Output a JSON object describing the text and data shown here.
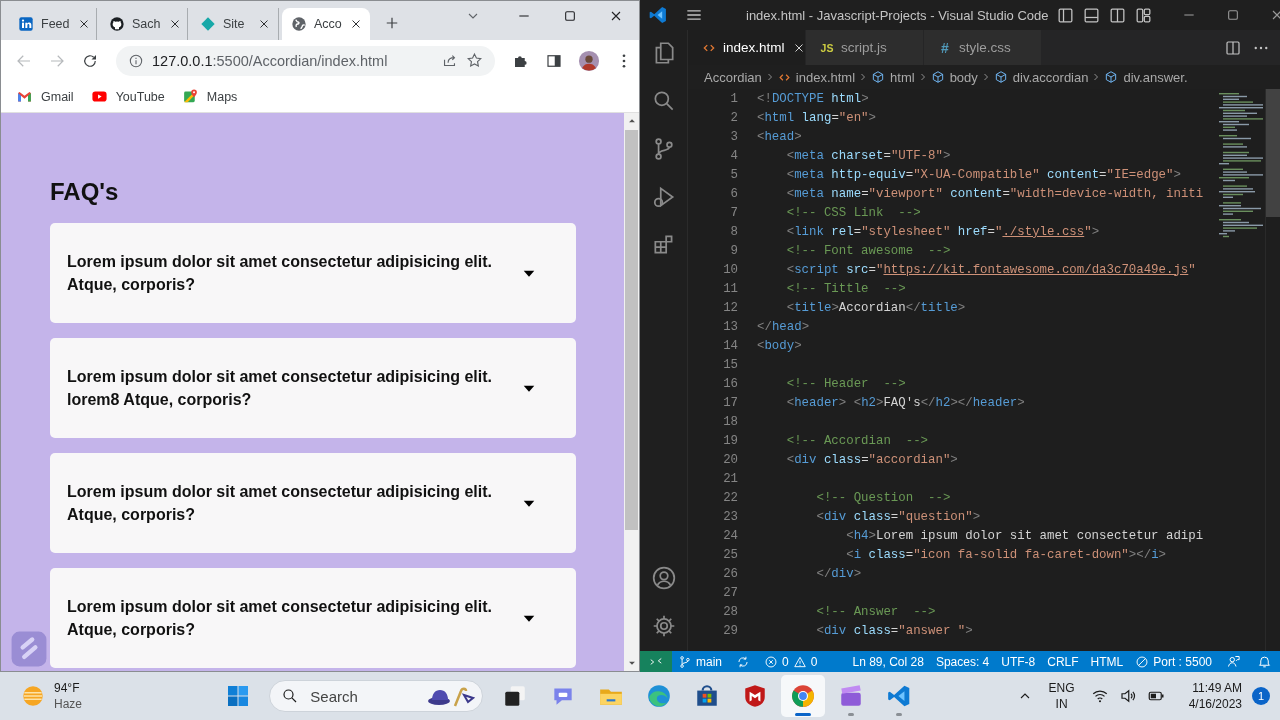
{
  "browser": {
    "tabs": [
      {
        "title": "Feed",
        "kind": "linkedin",
        "selected": false
      },
      {
        "title": "Sach",
        "kind": "github",
        "selected": false
      },
      {
        "title": "Site",
        "kind": "site",
        "selected": false
      },
      {
        "title": "Acco",
        "kind": "globe",
        "selected": true
      }
    ],
    "address": {
      "host": "127.0.0.1",
      "path": ":5500/Accordian/index.html"
    },
    "bookmarks": [
      {
        "label": "Gmail",
        "kind": "gmail"
      },
      {
        "label": "YouTube",
        "kind": "youtube"
      },
      {
        "label": "Maps",
        "kind": "maps"
      }
    ]
  },
  "page": {
    "heading": "FAQ's",
    "items": [
      {
        "question": "Lorem ipsum dolor sit amet consectetur adipisicing elit. Atque, corporis?",
        "expanded": false
      },
      {
        "question": "Lorem ipsum dolor sit amet consectetur adipisicing elit. lorem8 Atque, corporis?",
        "expanded": false
      },
      {
        "question": "Lorem ipsum dolor sit amet consectetur adipisicing elit. Atque, corporis?",
        "expanded": false
      },
      {
        "question": "Lorem ipsum dolor sit amet consectetur adipisicing elit. Atque, corporis?",
        "expanded": false
      }
    ]
  },
  "editor": {
    "title": "index.html - Javascript-Projects - Visual Studio Code",
    "tabs": [
      {
        "label": "index.html",
        "kind": "html",
        "selected": true
      },
      {
        "label": "script.js",
        "kind": "js",
        "icon_label": "JS",
        "selected": false
      },
      {
        "label": "style.css",
        "kind": "css",
        "icon_label": "#",
        "selected": false
      }
    ],
    "breadcrumbs": [
      {
        "label": "Accordian",
        "kind": "folder"
      },
      {
        "label": "index.html",
        "kind": "html"
      },
      {
        "label": "html",
        "kind": "element"
      },
      {
        "label": "body",
        "kind": "element"
      },
      {
        "label": "div.accordian",
        "kind": "element"
      },
      {
        "label": "div.answer.",
        "kind": "element"
      }
    ],
    "lines": [
      {
        "number": "1",
        "tokens": [
          {
            "kind": "punct",
            "text": "<!"
          },
          {
            "kind": "tag",
            "text": "DOCTYPE"
          },
          {
            "kind": "attr",
            "text": " html"
          },
          {
            "kind": "punct",
            "text": ">"
          }
        ]
      },
      {
        "number": "2",
        "tokens": [
          {
            "kind": "punct",
            "text": "<"
          },
          {
            "kind": "tag",
            "text": "html"
          },
          {
            "kind": "attr",
            "text": " lang"
          },
          {
            "kind": "op",
            "text": "="
          },
          {
            "kind": "string",
            "text": "\"en\""
          },
          {
            "kind": "punct",
            "text": ">"
          }
        ]
      },
      {
        "number": "3",
        "tokens": [
          {
            "kind": "punct",
            "text": "<"
          },
          {
            "kind": "tag",
            "text": "head"
          },
          {
            "kind": "punct",
            "text": ">"
          }
        ]
      },
      {
        "number": "4",
        "tokens": [
          {
            "kind": "punct",
            "text": "    <"
          },
          {
            "kind": "tag",
            "text": "meta"
          },
          {
            "kind": "attr",
            "text": " charset"
          },
          {
            "kind": "op",
            "text": "="
          },
          {
            "kind": "string",
            "text": "\"UTF-8\""
          },
          {
            "kind": "punct",
            "text": ">"
          }
        ]
      },
      {
        "number": "5",
        "tokens": [
          {
            "kind": "punct",
            "text": "    <"
          },
          {
            "kind": "tag",
            "text": "meta"
          },
          {
            "kind": "attr",
            "text": " http-equiv"
          },
          {
            "kind": "op",
            "text": "="
          },
          {
            "kind": "string",
            "text": "\"X-UA-Compatible\""
          },
          {
            "kind": "attr",
            "text": " content"
          },
          {
            "kind": "op",
            "text": "="
          },
          {
            "kind": "string",
            "text": "\"IE=edge\""
          },
          {
            "kind": "punct",
            "text": ">"
          }
        ]
      },
      {
        "number": "6",
        "tokens": [
          {
            "kind": "punct",
            "text": "    <"
          },
          {
            "kind": "tag",
            "text": "meta"
          },
          {
            "kind": "attr",
            "text": " name"
          },
          {
            "kind": "op",
            "text": "="
          },
          {
            "kind": "string",
            "text": "\"viewport\""
          },
          {
            "kind": "attr",
            "text": " content"
          },
          {
            "kind": "op",
            "text": "="
          },
          {
            "kind": "string",
            "text": "\"width=device-width, initi"
          }
        ]
      },
      {
        "number": "7",
        "tokens": [
          {
            "kind": "comment",
            "text": "    <!-- CSS Link  -->"
          }
        ]
      },
      {
        "number": "8",
        "tokens": [
          {
            "kind": "punct",
            "text": "    <"
          },
          {
            "kind": "tag",
            "text": "link"
          },
          {
            "kind": "attr",
            "text": " rel"
          },
          {
            "kind": "op",
            "text": "="
          },
          {
            "kind": "string",
            "text": "\"stylesheet\""
          },
          {
            "kind": "attr",
            "text": " href"
          },
          {
            "kind": "op",
            "text": "="
          },
          {
            "kind": "string",
            "text": "\""
          },
          {
            "kind": "link",
            "text": "./style.css"
          },
          {
            "kind": "string",
            "text": "\""
          },
          {
            "kind": "punct",
            "text": ">"
          }
        ]
      },
      {
        "number": "9",
        "tokens": [
          {
            "kind": "comment",
            "text": "    <!-- Font awesome  -->"
          }
        ]
      },
      {
        "number": "10",
        "tokens": [
          {
            "kind": "punct",
            "text": "    <"
          },
          {
            "kind": "tag",
            "text": "script"
          },
          {
            "kind": "attr",
            "text": " src"
          },
          {
            "kind": "op",
            "text": "="
          },
          {
            "kind": "string",
            "text": "\""
          },
          {
            "kind": "link",
            "text": "https://kit.fontawesome.com/da3c70a49e.js"
          },
          {
            "kind": "string",
            "text": "\""
          }
        ]
      },
      {
        "number": "11",
        "tokens": [
          {
            "kind": "comment",
            "text": "    <!-- Tittle  -->"
          }
        ]
      },
      {
        "number": "12",
        "tokens": [
          {
            "kind": "punct",
            "text": "    <"
          },
          {
            "kind": "tag",
            "text": "title"
          },
          {
            "kind": "punct",
            "text": ">"
          },
          {
            "kind": "text",
            "text": "Accordian"
          },
          {
            "kind": "punct",
            "text": "</"
          },
          {
            "kind": "tag",
            "text": "title"
          },
          {
            "kind": "punct",
            "text": ">"
          }
        ]
      },
      {
        "number": "13",
        "tokens": [
          {
            "kind": "punct",
            "text": "</"
          },
          {
            "kind": "tag",
            "text": "head"
          },
          {
            "kind": "punct",
            "text": ">"
          }
        ]
      },
      {
        "number": "14",
        "tokens": [
          {
            "kind": "punct",
            "text": "<"
          },
          {
            "kind": "tag",
            "text": "body"
          },
          {
            "kind": "punct",
            "text": ">"
          }
        ]
      },
      {
        "number": "15"
      },
      {
        "number": "16",
        "tokens": [
          {
            "kind": "comment",
            "text": "    <!-- Header  -->"
          }
        ]
      },
      {
        "number": "17",
        "tokens": [
          {
            "kind": "punct",
            "text": "    <"
          },
          {
            "kind": "tag",
            "text": "header"
          },
          {
            "kind": "punct",
            "text": "> <"
          },
          {
            "kind": "tag",
            "text": "h2"
          },
          {
            "kind": "punct",
            "text": ">"
          },
          {
            "kind": "text",
            "text": "FAQ's"
          },
          {
            "kind": "punct",
            "text": "</"
          },
          {
            "kind": "tag",
            "text": "h2"
          },
          {
            "kind": "punct",
            "text": "></"
          },
          {
            "kind": "tag",
            "text": "header"
          },
          {
            "kind": "punct",
            "text": ">"
          }
        ]
      },
      {
        "number": "18"
      },
      {
        "number": "19",
        "tokens": [
          {
            "kind": "comment",
            "text": "    <!-- Accordian  -->"
          }
        ]
      },
      {
        "number": "20",
        "tokens": [
          {
            "kind": "punct",
            "text": "    <"
          },
          {
            "kind": "tag",
            "text": "div"
          },
          {
            "kind": "attr",
            "text": " class"
          },
          {
            "kind": "op",
            "text": "="
          },
          {
            "kind": "string",
            "text": "\"accordian\""
          },
          {
            "kind": "punct",
            "text": ">"
          }
        ]
      },
      {
        "number": "21"
      },
      {
        "number": "22",
        "tokens": [
          {
            "kind": "comment",
            "text": "        <!-- Question  -->"
          }
        ]
      },
      {
        "number": "23",
        "tokens": [
          {
            "kind": "punct",
            "text": "        <"
          },
          {
            "kind": "tag",
            "text": "div"
          },
          {
            "kind": "attr",
            "text": " class"
          },
          {
            "kind": "op",
            "text": "="
          },
          {
            "kind": "string",
            "text": "\"question\""
          },
          {
            "kind": "punct",
            "text": ">"
          }
        ]
      },
      {
        "number": "24",
        "tokens": [
          {
            "kind": "punct",
            "text": "            <"
          },
          {
            "kind": "tag",
            "text": "h4"
          },
          {
            "kind": "punct",
            "text": ">"
          },
          {
            "kind": "text",
            "text": "Lorem ipsum dolor sit amet consectetur adipi"
          }
        ]
      },
      {
        "number": "25",
        "tokens": [
          {
            "kind": "punct",
            "text": "            <"
          },
          {
            "kind": "tag",
            "text": "i"
          },
          {
            "kind": "attr",
            "text": " class"
          },
          {
            "kind": "op",
            "text": "="
          },
          {
            "kind": "string",
            "text": "\"icon fa-solid fa-caret-down\""
          },
          {
            "kind": "punct",
            "text": "></"
          },
          {
            "kind": "tag",
            "text": "i"
          },
          {
            "kind": "punct",
            "text": ">"
          }
        ]
      },
      {
        "number": "26",
        "tokens": [
          {
            "kind": "punct",
            "text": "        </"
          },
          {
            "kind": "tag",
            "text": "div"
          },
          {
            "kind": "punct",
            "text": ">"
          }
        ]
      },
      {
        "number": "27"
      },
      {
        "number": "28",
        "tokens": [
          {
            "kind": "comment",
            "text": "        <!-- Answer  -->"
          }
        ]
      },
      {
        "number": "29",
        "tokens": [
          {
            "kind": "punct",
            "text": "        <"
          },
          {
            "kind": "tag",
            "text": "div"
          },
          {
            "kind": "attr",
            "text": " class"
          },
          {
            "kind": "op",
            "text": "="
          },
          {
            "kind": "string",
            "text": "\"answer \""
          },
          {
            "kind": "punct",
            "text": ">"
          }
        ]
      }
    ],
    "status_bar": {
      "branch": "main",
      "errors": "0",
      "warnings": "0",
      "items": [
        "Ln 89, Col 28",
        "Spaces: 4",
        "UTF-8",
        "CRLF",
        "HTML"
      ],
      "port": "Port : 5500"
    }
  },
  "taskbar": {
    "weather": {
      "temperature": "94°F",
      "condition": "Haze"
    },
    "search": {
      "placeholder": "Search"
    },
    "apps": [
      {
        "kind": "taskview",
        "selected": false,
        "open": false
      },
      {
        "kind": "chat",
        "selected": false,
        "open": false
      },
      {
        "kind": "explorer",
        "selected": false,
        "open": false
      },
      {
        "kind": "edge",
        "selected": false,
        "open": false
      },
      {
        "kind": "store",
        "selected": false,
        "open": false
      },
      {
        "kind": "security",
        "selected": false,
        "open": false
      },
      {
        "kind": "chrome",
        "selected": true,
        "open": true
      },
      {
        "kind": "video-editor",
        "selected": false,
        "open": true
      },
      {
        "kind": "vscode",
        "selected": false,
        "open": true
      }
    ],
    "language": {
      "lang": "ENG",
      "region": "IN"
    },
    "time": "11:49 AM",
    "date": "4/16/2023",
    "notifications": "1"
  }
}
